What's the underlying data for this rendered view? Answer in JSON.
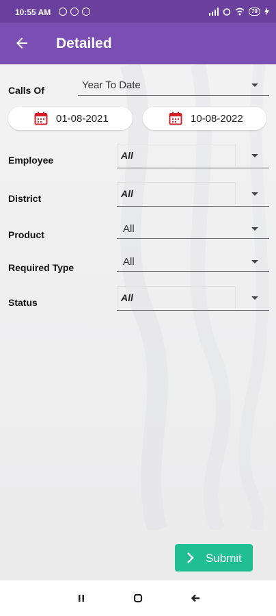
{
  "status_bar": {
    "time": "10:55 AM",
    "battery": "79",
    "icons": [
      "clock-icon",
      "sync-icon",
      "no-disturb-icon",
      "signal-icon",
      "alarm-icon",
      "wifi-icon",
      "battery-icon",
      "charging-icon"
    ]
  },
  "app_bar": {
    "title": "Detailed",
    "back_icon": "arrow-left-icon"
  },
  "form": {
    "calls_of": {
      "label": "Calls Of",
      "value": "Year To Date"
    },
    "date_from": "01-08-2021",
    "date_to": "10-08-2022",
    "employee": {
      "label": "Employee",
      "value": "All"
    },
    "district": {
      "label": "District",
      "value": "All"
    },
    "product": {
      "label": "Product",
      "value": "All"
    },
    "required_type": {
      "label": "Required Type",
      "value": "All"
    },
    "status": {
      "label": "Status",
      "value": "All"
    }
  },
  "submit": {
    "label": "Submit"
  },
  "colors": {
    "app_bar": "#7a4eb3",
    "status_bar": "#6a3f9e",
    "submit": "#1fbf93",
    "calendar": "#d0202a"
  },
  "nav_bar": {
    "icons": [
      "recents-icon",
      "home-icon",
      "back-icon"
    ]
  }
}
